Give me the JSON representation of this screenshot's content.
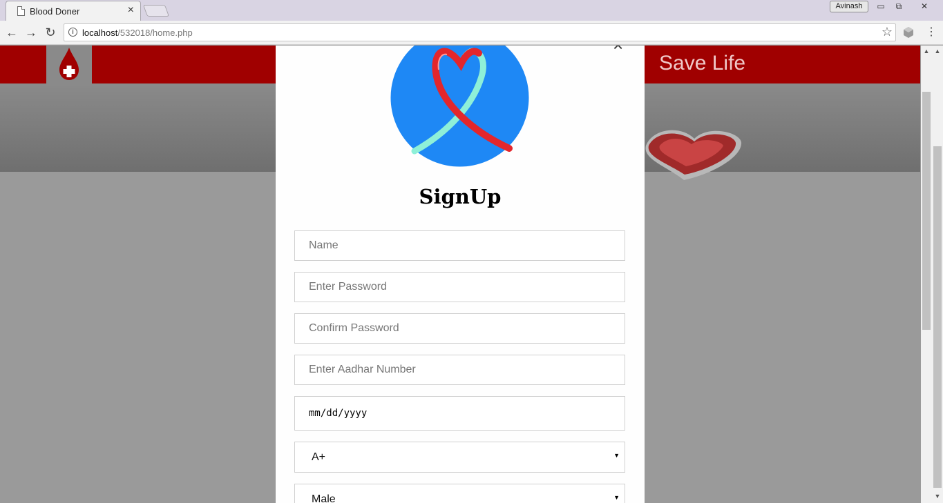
{
  "browser": {
    "tab_title": "Blood Doner",
    "tab_close": "×",
    "profile_name": "Avinash",
    "win_min": "▭",
    "win_max": "⧉",
    "win_close": "✕",
    "nav_back": "←",
    "nav_forward": "→",
    "nav_reload": "↻",
    "url_host": "localhost",
    "url_path": "/532018/home.php",
    "star": "☆",
    "menu": "⋮"
  },
  "header": {
    "tagline": "Save Life",
    "brand_color": "#a00000"
  },
  "modal": {
    "close": "×",
    "title": "SignUp",
    "fields": {
      "name_placeholder": "Name",
      "password_placeholder": "Enter Password",
      "confirm_placeholder": "Confirm Password",
      "aadhar_placeholder": "Enter Aadhar Number",
      "date_value": "mm/dd/yyyy",
      "blood_group": "A+",
      "gender": "Male"
    },
    "select_arrow": "▼"
  },
  "scroll": {
    "up": "▲",
    "down": "▼"
  },
  "colors": {
    "avatar_bg": "#1e88f5",
    "ribbon": "#e3262c",
    "ribbon_alt": "#8ef0d8"
  }
}
